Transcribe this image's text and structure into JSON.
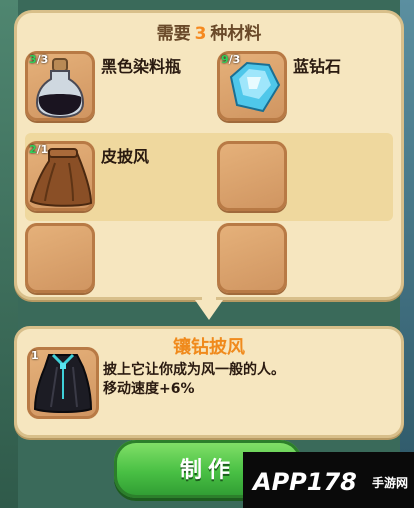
{
  "header": {
    "prefix": "需要",
    "count": "3",
    "suffix": "种材料"
  },
  "materials": [
    {
      "name": "黑色染料瓶",
      "have": "3",
      "need": "/3",
      "icon": "black-dye-bottle-icon"
    },
    {
      "name": "蓝钻石",
      "have": "9",
      "need": "/3",
      "icon": "blue-diamond-icon"
    },
    {
      "name": "皮披风",
      "have": "2",
      "need": "/1",
      "icon": "leather-cape-icon"
    }
  ],
  "result": {
    "title": "镶钻披风",
    "count": "1",
    "desc_line1": "披上它让你成为风一般的人。",
    "desc_line2": "移动速度+6%"
  },
  "craft_button": {
    "label": "制作"
  },
  "watermark": {
    "text": "APP178",
    "sub": "手游网"
  }
}
